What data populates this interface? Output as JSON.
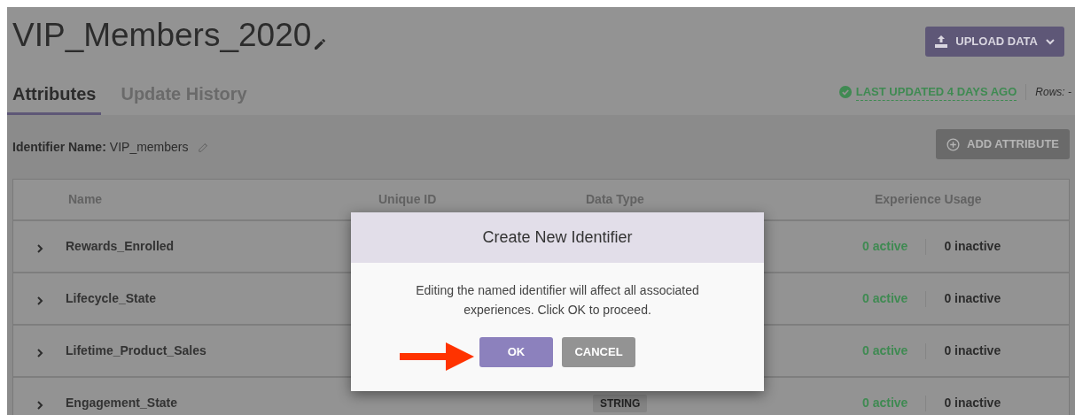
{
  "page": {
    "title": "VIP_Members_2020",
    "upload_button": "UPLOAD DATA",
    "tabs": [
      {
        "label": "Attributes",
        "selected": true
      },
      {
        "label": "Update History",
        "selected": false
      }
    ],
    "last_updated": "LAST UPDATED 4 DAYS AGO",
    "rows_label": "Rows: -"
  },
  "identifier": {
    "label": "Identifier Name:",
    "value": "VIP_members"
  },
  "add_button": "ADD ATTRIBUTE",
  "table": {
    "columns": [
      "Name",
      "Unique ID",
      "Data Type",
      "Experience Usage"
    ],
    "rows": [
      {
        "name": "Rewards_Enrolled",
        "active": "0 active",
        "inactive": "0 inactive"
      },
      {
        "name": "Lifecycle_State",
        "active": "0 active",
        "inactive": "0 inactive"
      },
      {
        "name": "Lifetime_Product_Sales",
        "active": "0 active",
        "inactive": "0 inactive"
      },
      {
        "name": "Engagement_State",
        "data_type": "STRING",
        "active": "0 active",
        "inactive": "0 inactive"
      }
    ]
  },
  "dialog": {
    "title": "Create New Identifier",
    "message": "Editing the named identifier will affect all associated experiences. Click OK to proceed.",
    "buttons": [
      {
        "label": "OK",
        "kind": "primary"
      },
      {
        "label": "CANCEL",
        "kind": "secondary"
      }
    ]
  }
}
